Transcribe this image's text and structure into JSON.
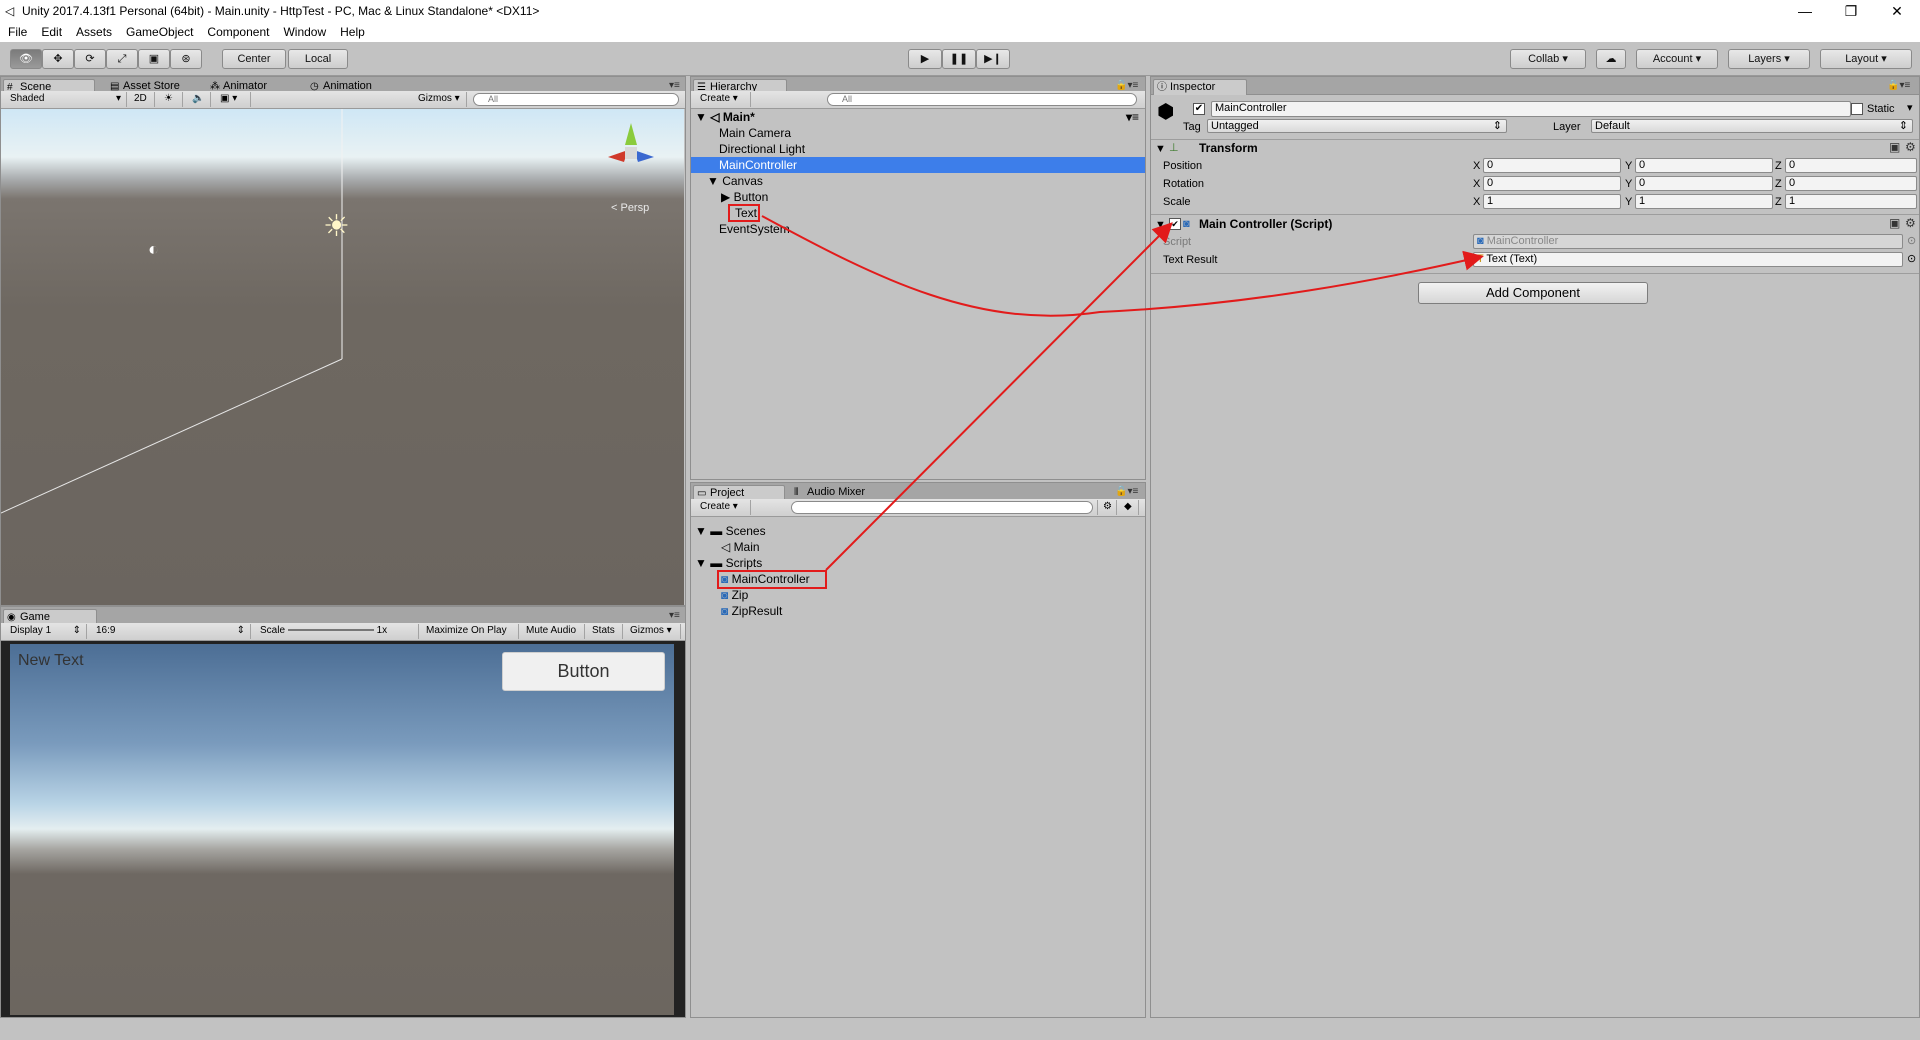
{
  "window": {
    "title": "Unity 2017.4.13f1 Personal (64bit) - Main.unity - HttpTest - PC, Mac & Linux Standalone* <DX11>",
    "minimize": "—",
    "maximize": "❐",
    "close": "✕"
  },
  "menu": [
    "File",
    "Edit",
    "Assets",
    "GameObject",
    "Component",
    "Window",
    "Help"
  ],
  "toolbar": {
    "pivot": "Center",
    "space": "Local",
    "collab": "Collab ▾",
    "account": "Account",
    "layers": "Layers",
    "layout": "Layout"
  },
  "scene_panel": {
    "tabs": [
      "Scene",
      "Asset Store",
      "Animator",
      "Animation"
    ],
    "shading": "Shaded",
    "mode_2d": "2D",
    "gizmos": "Gizmos",
    "search_placeholder": "All",
    "persp": "< Persp"
  },
  "game_panel": {
    "tab": "Game",
    "display": "Display 1",
    "aspect": "16:9",
    "scale_label": "Scale",
    "scale_value": "1x",
    "maximize": "Maximize On Play",
    "mute": "Mute Audio",
    "stats": "Stats",
    "gizmos": "Gizmos",
    "new_text": "New Text",
    "button_label": "Button"
  },
  "hierarchy": {
    "tab": "Hierarchy",
    "create": "Create",
    "search_placeholder": "All",
    "scene": "Main*",
    "items": [
      "Main Camera",
      "Directional Light",
      "MainController",
      "Canvas",
      "Button",
      "Text",
      "EventSystem"
    ]
  },
  "project": {
    "tabs": [
      "Project",
      "Audio Mixer"
    ],
    "create": "Create",
    "folders": [
      "Scenes",
      "Main",
      "Scripts",
      "MainController",
      "Zip",
      "ZipResult"
    ]
  },
  "inspector": {
    "tab": "Inspector",
    "object_name": "MainController",
    "static": "Static",
    "tag_label": "Tag",
    "tag_value": "Untagged",
    "layer_label": "Layer",
    "layer_value": "Default",
    "transform": {
      "title": "Transform",
      "rows": [
        {
          "label": "Position",
          "x": "0",
          "y": "0",
          "z": "0"
        },
        {
          "label": "Rotation",
          "x": "0",
          "y": "0",
          "z": "0"
        },
        {
          "label": "Scale",
          "x": "1",
          "y": "1",
          "z": "1"
        }
      ]
    },
    "script_component": {
      "title": "Main Controller (Script)",
      "script_label": "Script",
      "script_value": "MainController",
      "text_result_label": "Text Result",
      "text_result_value": "Text (Text)"
    },
    "add_component": "Add Component"
  },
  "axes": {
    "x": "X",
    "y": "Y",
    "z": "Z"
  }
}
